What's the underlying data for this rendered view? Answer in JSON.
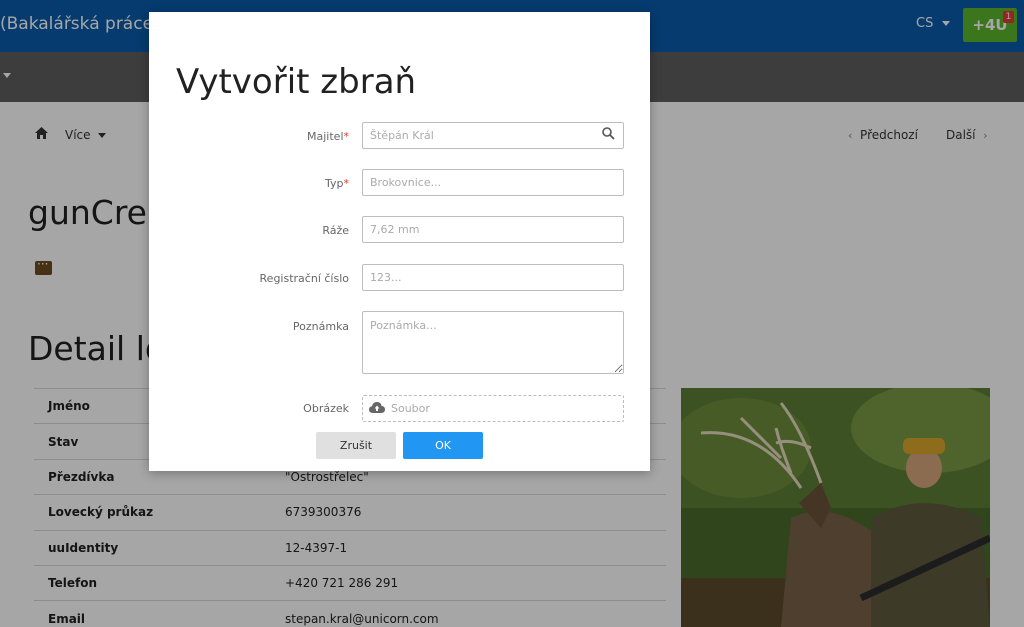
{
  "app": {
    "title": "(Bakalářská práce -",
    "language": "CS",
    "plus4u_label": "+4U",
    "notification_count": "1"
  },
  "nav": {
    "more_label": "Více",
    "prev_label": "Předchozí",
    "next_label": "Další"
  },
  "page": {
    "route_title": "gunCrea",
    "detail_title": "Detail lo"
  },
  "table": {
    "rows": [
      {
        "label": "Jméno",
        "value": ""
      },
      {
        "label": "Stav",
        "value": ""
      },
      {
        "label": "Přezdívka",
        "value": "\"Ostrostřelec\""
      },
      {
        "label": "Lovecký průkaz",
        "value": "6739300376"
      },
      {
        "label": "uuIdentity",
        "value": "12-4397-1"
      },
      {
        "label": "Telefon",
        "value": "+420 721 286 291"
      },
      {
        "label": "Email",
        "value": "stepan.kral@unicorn.com"
      }
    ]
  },
  "modal": {
    "title": "Vytvořit zbraň",
    "owner_label": "Majitel",
    "owner_placeholder": "Štěpán Král",
    "type_label": "Typ",
    "type_placeholder": "Brokovnice...",
    "caliber_label": "Ráže",
    "caliber_placeholder": "7,62 mm",
    "reg_label": "Registrační číslo",
    "reg_placeholder": "123...",
    "note_label": "Poznámka",
    "note_placeholder": "Poznámka...",
    "image_label": "Obrázek",
    "file_placeholder": "Soubor",
    "cancel_label": "Zrušit",
    "ok_label": "OK",
    "required_mark": "*"
  },
  "colors": {
    "appbar": "#0a5bab",
    "plus4u": "#5cb62b",
    "primary_button": "#2196f3",
    "required": "#e53935"
  }
}
